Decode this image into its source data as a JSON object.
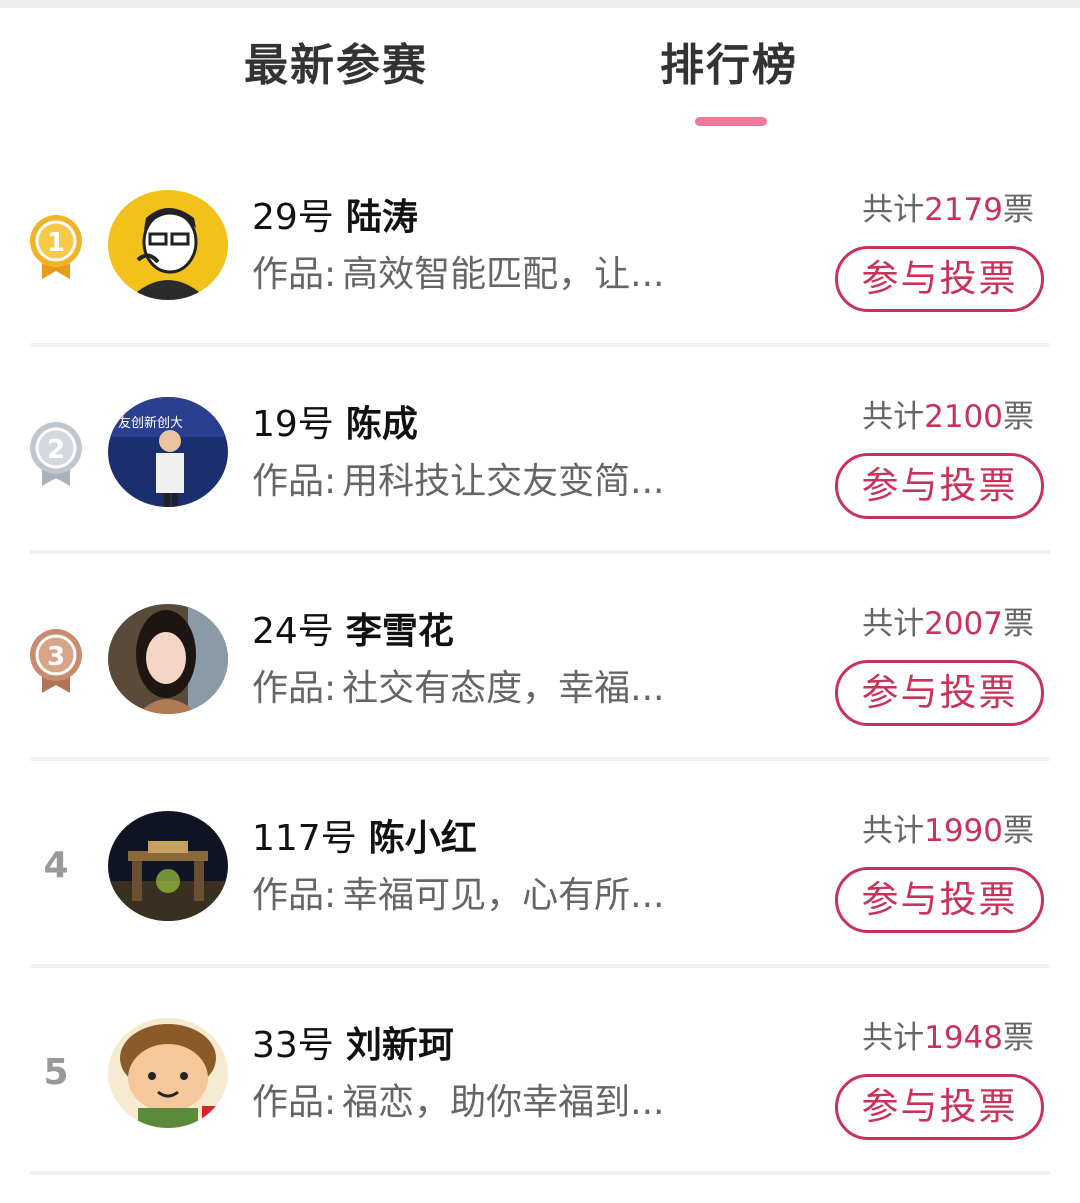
{
  "tabs": {
    "latest_label": "最新参赛",
    "rank_label": "排行榜",
    "active": "rank"
  },
  "colors": {
    "accent": "#c9325a",
    "indicator": "#f07a9a",
    "gold": "#f0b429",
    "silver": "#bfc6cf",
    "bronze": "#c98b6e"
  },
  "entries": [
    {
      "rank_display": "",
      "medal": "gold",
      "medal_digit": "1",
      "avatar_icon": "cartoon-man-icon",
      "number": "29号",
      "name": "陆涛",
      "work_prefix": "作品:",
      "work_title": "高效智能匹配，让...",
      "votes_prefix": "共计",
      "votes_count": "2179",
      "votes_suffix": "票",
      "button": "参与投票"
    },
    {
      "rank_display": "",
      "medal": "silver",
      "medal_digit": "2",
      "avatar_icon": "speaker-stage-icon",
      "number": "19号",
      "name": "陈成",
      "work_prefix": "作品:",
      "work_title": "用科技让交友变简...",
      "votes_prefix": "共计",
      "votes_count": "2100",
      "votes_suffix": "票",
      "button": "参与投票"
    },
    {
      "rank_display": "",
      "medal": "bronze",
      "medal_digit": "3",
      "avatar_icon": "woman-portrait-icon",
      "number": "24号",
      "name": "李雪花",
      "work_prefix": "作品:",
      "work_title": "社交有态度，幸福...",
      "votes_prefix": "共计",
      "votes_count": "2007",
      "votes_suffix": "票",
      "button": "参与投票"
    },
    {
      "rank_display": "4",
      "medal": "",
      "medal_digit": "",
      "avatar_icon": "night-gate-icon",
      "number": "117号",
      "name": "陈小红",
      "work_prefix": "作品:",
      "work_title": "幸福可见，心有所...",
      "votes_prefix": "共计",
      "votes_count": "1990",
      "votes_suffix": "票",
      "button": "参与投票"
    },
    {
      "rank_display": "5",
      "medal": "",
      "medal_digit": "",
      "avatar_icon": "cartoon-boy-icon",
      "number": "33号",
      "name": "刘新珂",
      "work_prefix": "作品:",
      "work_title": "福恋，助你幸福到...",
      "votes_prefix": "共计",
      "votes_count": "1948",
      "votes_suffix": "票",
      "button": "参与投票"
    }
  ]
}
